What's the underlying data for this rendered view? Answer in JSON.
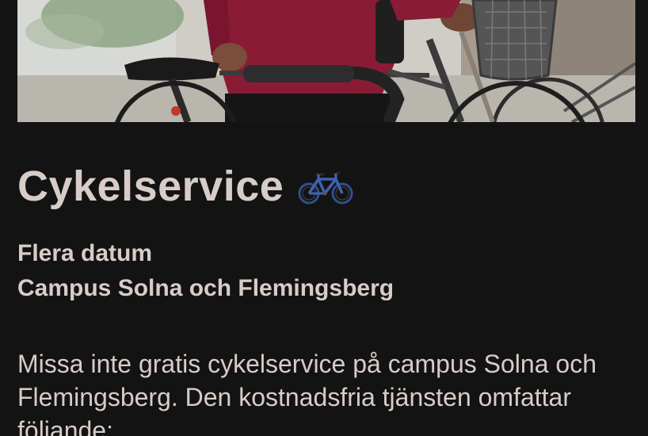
{
  "hero": {
    "image_icon": "bicycle-photo"
  },
  "event": {
    "title": "Cykelservice",
    "title_icon": "bicycle-icon",
    "date": "Flera datum",
    "location": "Campus Solna och Flemingsberg",
    "description": "Missa inte gratis cykelservice på campus Solna och Flemingsberg. Den kostnadsfria tjänsten omfattar följande:"
  },
  "colors": {
    "background": "#141313",
    "text": "#d8ccc8",
    "accent_jacket": "#8a1b35",
    "bike_icon": "#3f63b0"
  }
}
